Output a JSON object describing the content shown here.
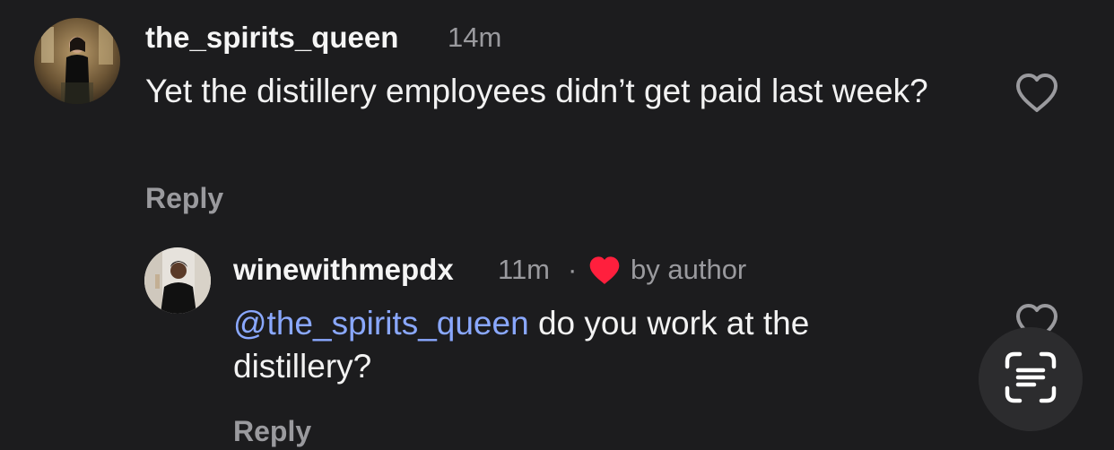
{
  "comments": [
    {
      "username": "the_spirits_queen",
      "time": "14m",
      "text": "Yet the distillery employees didn’t get paid last week?",
      "reply_label": "Reply",
      "like_icon": "heart-outline-icon"
    }
  ],
  "reply": {
    "username": "winewithmepdx",
    "time": "11m",
    "separator": "·",
    "liked_by_author_icon": "heart-filled-icon",
    "liked_by_label": "by author",
    "mention": "@the_spirits_queen",
    "text": " do you work at the distillery?",
    "reply_label": "Reply",
    "like_icon": "heart-outline-icon"
  },
  "floating_button": {
    "icon": "text-scan-icon"
  },
  "colors": {
    "background": "#1c1c1e",
    "text": "#f2f2f2",
    "secondary": "#9a9a9e",
    "mention": "#8aa8ff",
    "heart_red": "#ff1f3d"
  }
}
